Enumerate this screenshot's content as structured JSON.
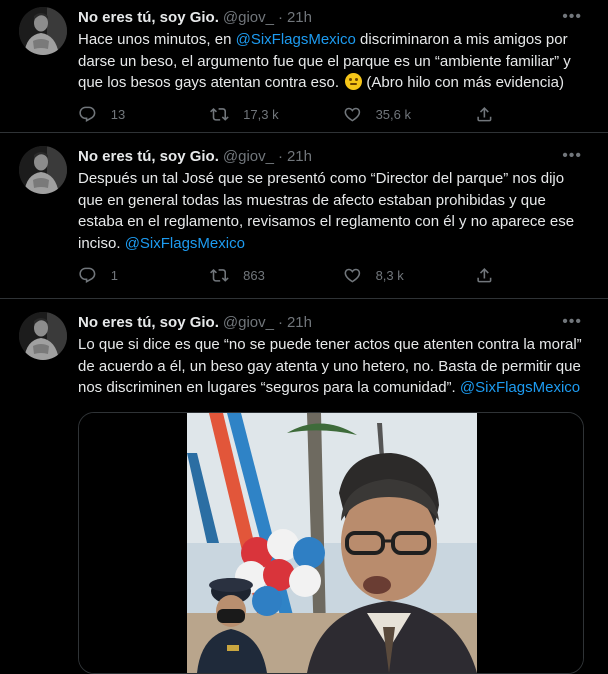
{
  "tweets": [
    {
      "name": "No eres tú, soy Gio.",
      "handle": "@giov_",
      "dot": "·",
      "time": "21h",
      "text_a": "Hace unos minutos, en ",
      "mention_a": "@SixFlagsMexico",
      "text_b": " discriminaron a mis amigos por darse un beso, el argumento fue que el parque es un “ambiente familiar” y que los besos gays atentan contra eso. ",
      "text_c": " (Abro hilo con más evidencia)",
      "emoji": "thinking-face",
      "replies": "13",
      "retweets": "17,3 k",
      "likes": "35,6 k"
    },
    {
      "name": "No eres tú, soy Gio.",
      "handle": "@giov_",
      "dot": "·",
      "time": "21h",
      "text_a": "Después un tal José que se presentó como “Director del parque” nos dijo que en general todas las muestras de afecto estaban prohibidas y que estaba en el reglamento, revisamos el reglamento con él y no aparece ese inciso. ",
      "mention_a": "@SixFlagsMexico",
      "replies": "1",
      "retweets": "863",
      "likes": "8,3 k"
    },
    {
      "name": "No eres tú, soy Gio.",
      "handle": "@giov_",
      "dot": "·",
      "time": "21h",
      "text_a": "Lo que si dice es que “no se puede tener actos que atenten contra la moral” de acuerdo a él, un beso gay atenta y uno hetero, no. Basta de permitir que nos discriminen en lugares “seguros para la comunidad”. ",
      "mention_a": "@SixFlagsMexico"
    }
  ],
  "icons": {
    "more": "more-options-icon",
    "reply": "reply-icon",
    "retweet": "retweet-icon",
    "like": "like-icon",
    "share": "share-icon"
  },
  "colors": {
    "background": "#000000",
    "text": "#e7e9ea",
    "muted": "#71767b",
    "link": "#1d9bf0",
    "border": "#2f3336"
  }
}
